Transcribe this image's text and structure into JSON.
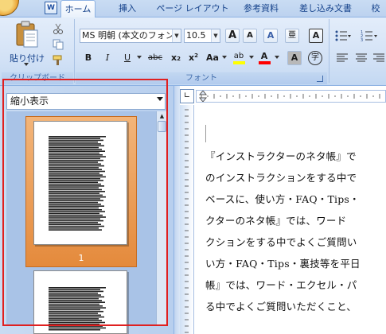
{
  "quick_access": {
    "app_icon": "word-icon",
    "app_letter": "W"
  },
  "tabs": [
    {
      "label": "ホーム",
      "active": true
    },
    {
      "label": "挿入"
    },
    {
      "label": "ページ レイアウト"
    },
    {
      "label": "参考資料"
    },
    {
      "label": "差し込み文書"
    },
    {
      "label": "校"
    }
  ],
  "ribbon": {
    "clipboard": {
      "paste_label": "貼り付け",
      "group_label": "クリップボード"
    },
    "font": {
      "font_name": "MS 明朝 (本文のフォン",
      "font_size": "10.5",
      "group_label": "フォント",
      "buttons": {
        "grow": "A",
        "shrink": "A",
        "clear": "A",
        "phonetic": "亜",
        "border": "A",
        "bold": "B",
        "italic": "I",
        "underline": "U",
        "strike": "abc",
        "subscript": "x",
        "superscript": "x",
        "case": "Aa",
        "highlight": "ab",
        "font_color": "A",
        "shading": "A",
        "enclose": "字"
      }
    },
    "colors": {
      "highlight": "#ffff00",
      "font_color": "#ff0000"
    }
  },
  "navigation": {
    "view_select": "縮小表示",
    "page_number": "1"
  },
  "document": {
    "lines": [
      "『インストラクターのネタ帳』で",
      "のインストラクションをする中で",
      "ベースに、使い方・FAQ・Tips・",
      "クターのネタ帳』では、ワード",
      "クションをする中でよくご質問い",
      "い方・FAQ・Tips・裏技等を平日",
      "帳』では、ワード・エクセル・パ",
      "る中でよくご質問いただくこと、"
    ]
  }
}
